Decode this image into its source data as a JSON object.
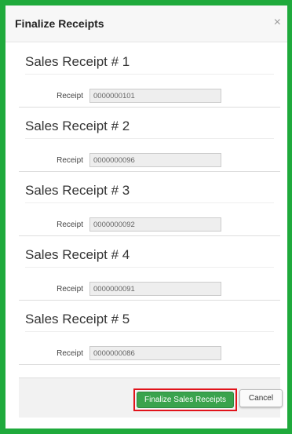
{
  "modal": {
    "title": "Finalize Receipts",
    "close_symbol": "×"
  },
  "receipts": [
    {
      "title": "Sales Receipt # 1",
      "label": "Receipt",
      "value": "0000000101"
    },
    {
      "title": "Sales Receipt # 2",
      "label": "Receipt",
      "value": "0000000096"
    },
    {
      "title": "Sales Receipt # 3",
      "label": "Receipt",
      "value": "0000000092"
    },
    {
      "title": "Sales Receipt # 4",
      "label": "Receipt",
      "value": "0000000091"
    },
    {
      "title": "Sales Receipt # 5",
      "label": "Receipt",
      "value": "0000000086"
    }
  ],
  "footer": {
    "finalize_label": "Finalize Sales Receipts",
    "cancel_label": "Cancel"
  },
  "colors": {
    "frame": "#1faa3c",
    "finalize_button": "#3aa34d",
    "highlight": "#e1131a"
  }
}
